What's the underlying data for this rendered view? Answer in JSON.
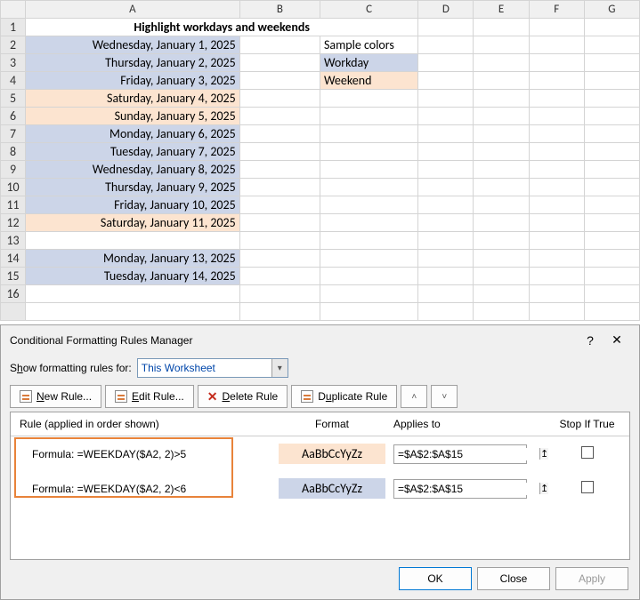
{
  "cols": [
    "A",
    "B",
    "C",
    "D",
    "E",
    "F",
    "G"
  ],
  "title": "Highlight workdays and weekends",
  "sample_hdr": "Sample colors",
  "sample_wd": "Workday",
  "sample_we": "Weekend",
  "dates": [
    {
      "row": 2,
      "text": "Wednesday, January 1, 2025",
      "cls": "wd"
    },
    {
      "row": 3,
      "text": "Thursday, January 2, 2025",
      "cls": "wd"
    },
    {
      "row": 4,
      "text": "Friday, January 3, 2025",
      "cls": "wd"
    },
    {
      "row": 5,
      "text": "Saturday, January 4, 2025",
      "cls": "we"
    },
    {
      "row": 6,
      "text": "Sunday, January 5, 2025",
      "cls": "we"
    },
    {
      "row": 7,
      "text": "Monday, January 6, 2025",
      "cls": "wd"
    },
    {
      "row": 8,
      "text": "Tuesday, January 7, 2025",
      "cls": "wd"
    },
    {
      "row": 9,
      "text": "Wednesday, January 8, 2025",
      "cls": "wd"
    },
    {
      "row": 10,
      "text": "Thursday, January 9, 2025",
      "cls": "wd"
    },
    {
      "row": 11,
      "text": "Friday, January 10, 2025",
      "cls": "wd"
    },
    {
      "row": 12,
      "text": "Saturday, January 11, 2025",
      "cls": "we"
    },
    {
      "row": 14,
      "text": "Monday, January 13, 2025",
      "cls": "wd"
    },
    {
      "row": 15,
      "text": "Tuesday, January 14, 2025",
      "cls": "wd"
    }
  ],
  "dialog": {
    "title": "Conditional Formatting Rules Manager",
    "show_label_pre": "S",
    "show_label_u": "h",
    "show_label_post": "ow formatting rules for:",
    "scope": "This Worksheet",
    "new_u": "N",
    "new_post": "ew Rule...",
    "edit_u": "E",
    "edit_post": "dit Rule...",
    "del_u": "D",
    "del_post": "elete Rule",
    "dup_pre": "D",
    "dup_u": "u",
    "dup_post": "plicate Rule",
    "hdr_rule": "Rule (applied in order shown)",
    "hdr_format": "Format",
    "hdr_applies": "Applies to",
    "hdr_stop": "Stop If True",
    "rules": [
      {
        "formula": "Formula: =WEEKDAY($A2, 2)>5",
        "cls": "we",
        "range": "=$A$2:$A$15"
      },
      {
        "formula": "Formula: =WEEKDAY($A2, 2)<6",
        "cls": "wd",
        "range": "=$A$2:$A$15"
      }
    ],
    "preview": "AaBbCcYyZz",
    "ok": "OK",
    "close": "Close",
    "apply": "Apply"
  }
}
